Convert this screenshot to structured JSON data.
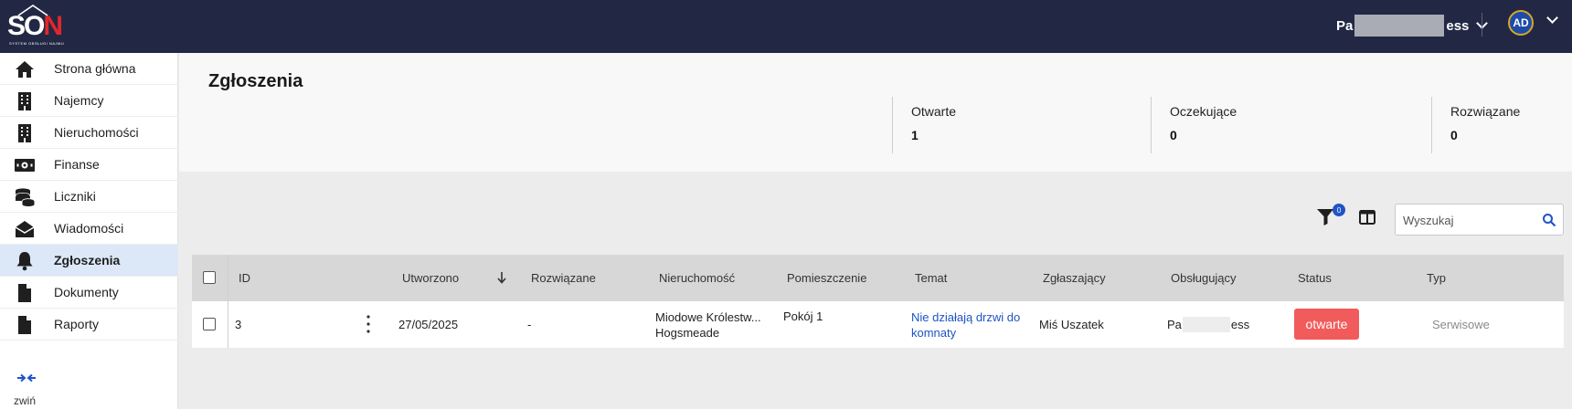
{
  "app": {
    "logo_text_main": "SO",
    "logo_text_accent": "N",
    "logo_tagline": "SYSTEM OBSŁUGI NAJMU"
  },
  "topbar": {
    "company_prefix": "Pa",
    "company_suffix": "ess",
    "user_initials": "AD"
  },
  "sidebar": {
    "items": [
      {
        "label": "Strona główna",
        "icon": "home-icon"
      },
      {
        "label": "Najemcy",
        "icon": "building-icon"
      },
      {
        "label": "Nieruchomości",
        "icon": "building-icon"
      },
      {
        "label": "Finanse",
        "icon": "money-icon"
      },
      {
        "label": "Liczniki",
        "icon": "coins-icon"
      },
      {
        "label": "Wiadomości",
        "icon": "envelope-icon"
      },
      {
        "label": "Zgłoszenia",
        "icon": "bell-icon",
        "active": true
      },
      {
        "label": "Dokumenty",
        "icon": "document-icon"
      },
      {
        "label": "Raporty",
        "icon": "document-icon"
      }
    ],
    "collapse_label": "zwiń"
  },
  "header": {
    "title": "Zgłoszenia",
    "stats": [
      {
        "label": "Otwarte",
        "value": "1"
      },
      {
        "label": "Oczekujące",
        "value": "0"
      },
      {
        "label": "Rozwiązane",
        "value": "0"
      }
    ]
  },
  "toolbar": {
    "filter_count": "0",
    "search_placeholder": "Wyszukaj"
  },
  "table": {
    "columns": [
      "ID",
      "Utworzono",
      "Rozwiązane",
      "Nieruchomość",
      "Pomieszczenie",
      "Temat",
      "Zgłaszający",
      "Obsługujący",
      "Status",
      "Typ"
    ],
    "rows": [
      {
        "id": "3",
        "created": "27/05/2025",
        "resolved": "-",
        "property_line1": "Miodowe Królestw...",
        "property_line2": "Hogsmeade",
        "room": "Pokój 1",
        "subject_line1": "Nie działają drzwi do",
        "subject_line2": "komnaty",
        "reporter": "Miś Uszatek",
        "handler_prefix": "Pa",
        "handler_suffix": "ess",
        "status": "otwarte",
        "type": "Serwisowe"
      }
    ]
  },
  "colors": {
    "topbar": "#222844",
    "accent_blue": "#1f54c8",
    "status_open": "#f25b5b",
    "active_nav": "#dce8f8"
  }
}
